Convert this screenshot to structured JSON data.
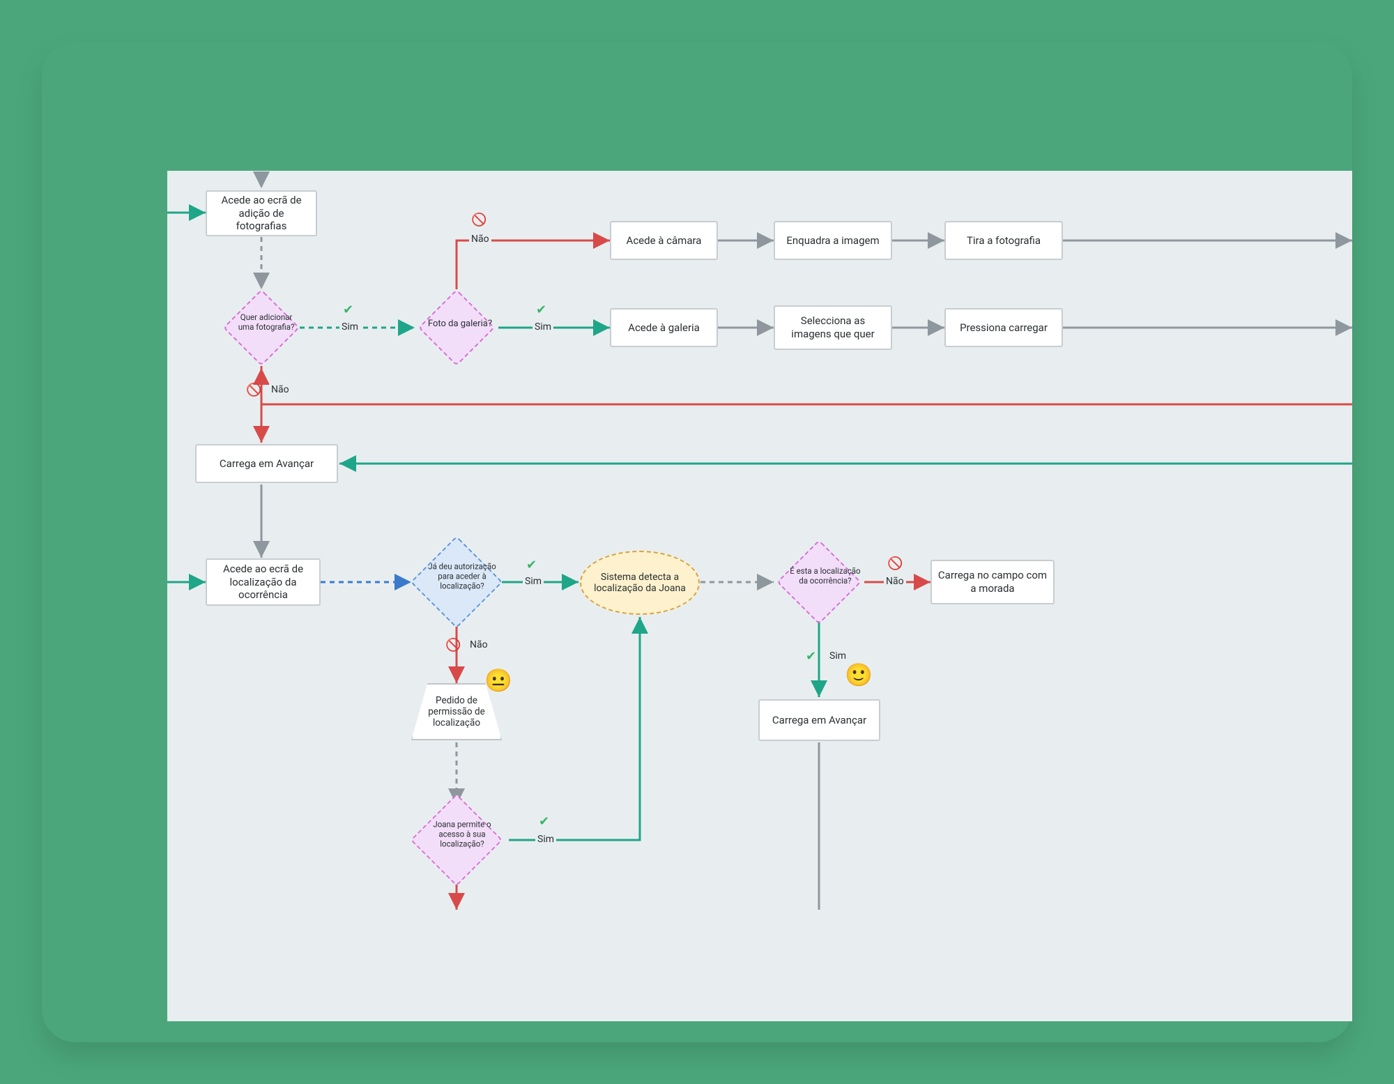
{
  "nodes": {
    "n1": "Acede ao ecrã de adição de fotografias",
    "d1": "Quer adicionar uma fotografia?",
    "d2": "Foto da galeria?",
    "n2": "Acede à câmara",
    "n3": "Enquadra a imagem",
    "n4": "Tira a fotografia",
    "n5": "Acede à galeria",
    "n6": "Selecciona as imagens que quer",
    "n7": "Pressiona carregar",
    "n8": "Carrega em Avançar",
    "n9": "Acede ao ecrã de localização da ocorrência",
    "d3": "Já deu autorização para aceder à localização?",
    "e1": "Sistema detecta a localização da Joana",
    "d4": "É esta a localização da ocorrência?",
    "n10": "Carrega no campo com a morada",
    "t1": "Pedido de permissão de localização",
    "d5": "Joana permite o acesso à sua localização?",
    "n11": "Carrega em Avançar"
  },
  "labels": {
    "sim": "Sim",
    "nao": "Não"
  },
  "icons": {
    "yes": "✔",
    "no": "🚫"
  },
  "emoji": {
    "neutral": "😐",
    "smile": "🙂"
  },
  "colors": {
    "teal": "#1fa588",
    "red": "#d84a4a",
    "gray": "#8e979d",
    "blue": "#3b7acb"
  }
}
